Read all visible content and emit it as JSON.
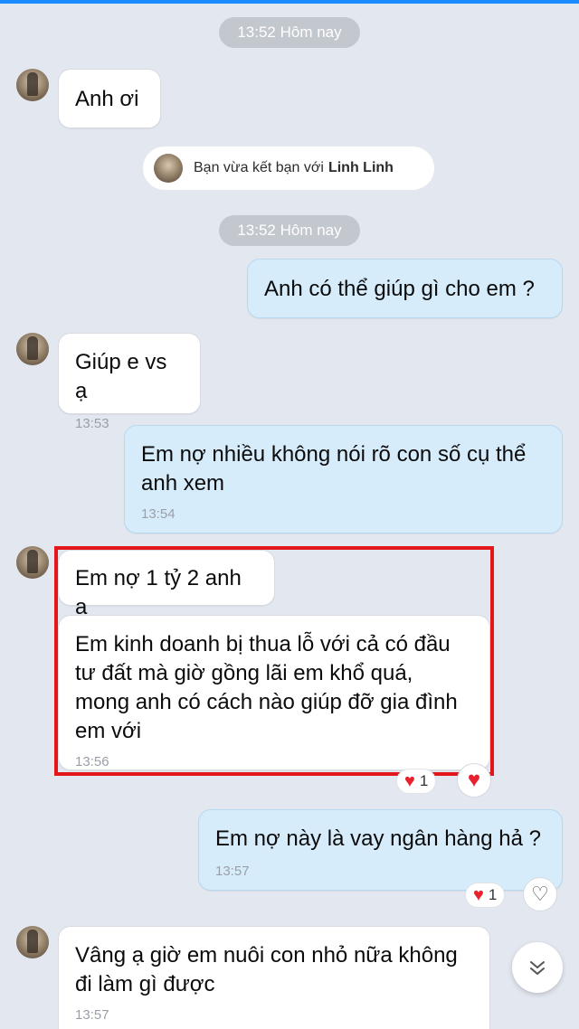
{
  "time_divider_1": "13:52 Hôm nay",
  "time_divider_2": "13:52 Hôm nay",
  "notice": {
    "prefix": "Bạn vừa kết bạn với",
    "name": "Linh Linh"
  },
  "messages": [
    {
      "text": "Anh ơi",
      "time": ""
    },
    {
      "text": "Anh có thể giúp gì cho em ?",
      "time": ""
    },
    {
      "text": "Giúp e vs ạ",
      "time": "13:53"
    },
    {
      "text": "Em nợ nhiều không nói rõ con số cụ thể anh xem",
      "time": "13:54"
    },
    {
      "text": "Em nợ 1 tỷ 2 anh ạ",
      "time": ""
    },
    {
      "text": "Em kinh doanh bị thua lỗ với cả có đầu tư đất mà giờ gồng lãi em khổ quá, mong anh có cách nào giúp đỡ gia đình em với",
      "time": "13:56"
    },
    {
      "text": "Em nợ này là vay ngân hàng hả ?",
      "time": "13:57"
    },
    {
      "text": "Vâng ạ giờ em nuôi con nhỏ nữa không đi làm gì được",
      "time": "13:57"
    }
  ],
  "reactions": [
    {
      "count": "1"
    },
    {
      "count": "1"
    }
  ],
  "icons": {
    "heart": "heart-icon",
    "heart_outline": "heart-outline-icon",
    "scroll_down": "double-chevron-down-icon"
  },
  "colors": {
    "background": "#e3e7ef",
    "incoming_bubble": "#ffffff",
    "outgoing_bubble": "#d6ecfb",
    "highlight_box": "#e3171b",
    "heart": "#e8212e",
    "top_accent": "#1a8cff"
  }
}
